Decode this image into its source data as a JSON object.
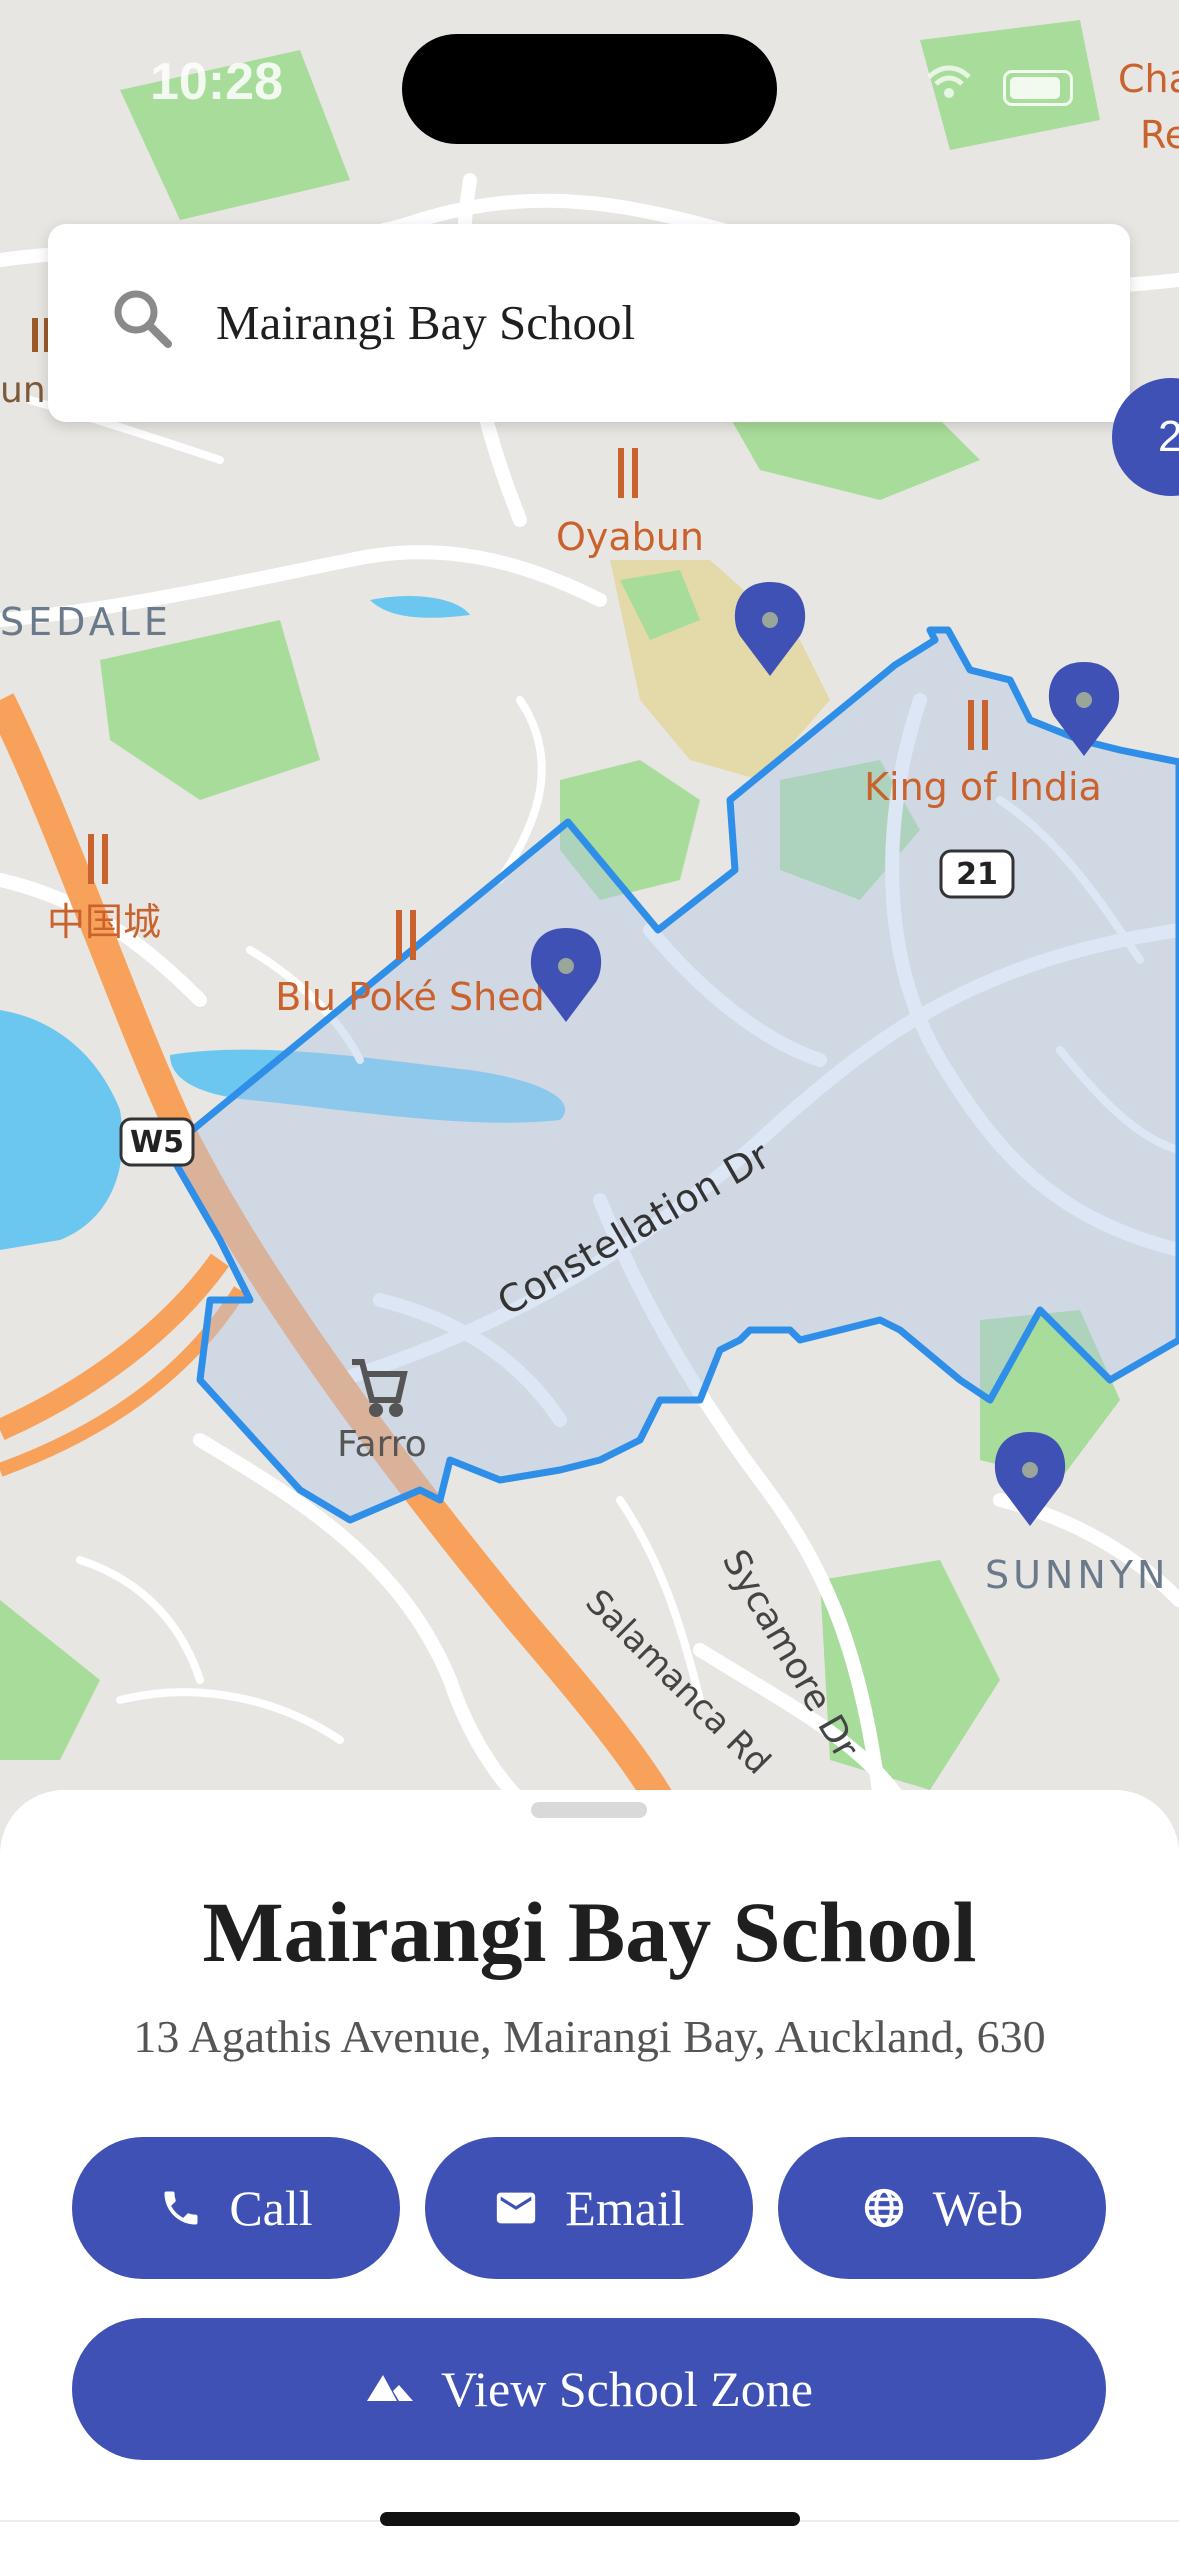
{
  "status_bar": {
    "time": "10:28"
  },
  "search": {
    "query": "Mairangi Bay School",
    "icon": "search-icon"
  },
  "map": {
    "labels": {
      "oyabun": "Oyabun",
      "king_of_india": "King of India",
      "zhongguocheng": "中国城",
      "blu_poke": "Blu Poké Shed",
      "constellation": "Constellation Dr",
      "farro": "Farro",
      "sycamore": "Sycamore Dr",
      "salamanca": "Salamanca Rd",
      "sedale": "SEDALE",
      "sunny": "SUNNYN",
      "route21": "21",
      "motorway": "W5",
      "edge_top_right_1": "Cha",
      "edge_top_right_2": "Re",
      "edge_left": "un"
    },
    "cluster_count": "2",
    "zone_color": "#2f8fe8",
    "pin_color": "#3f51b5"
  },
  "sheet": {
    "title": "Mairangi Bay School",
    "address": "13 Agathis Avenue, Mairangi Bay, Auckland, 630",
    "buttons": {
      "call": "Call",
      "email": "Email",
      "web": "Web",
      "zone": "View School Zone"
    }
  },
  "colors": {
    "accent": "#3f51b5",
    "motorway": "#f7a15a",
    "water": "#6cc7f0",
    "park": "#a8dc9a"
  }
}
